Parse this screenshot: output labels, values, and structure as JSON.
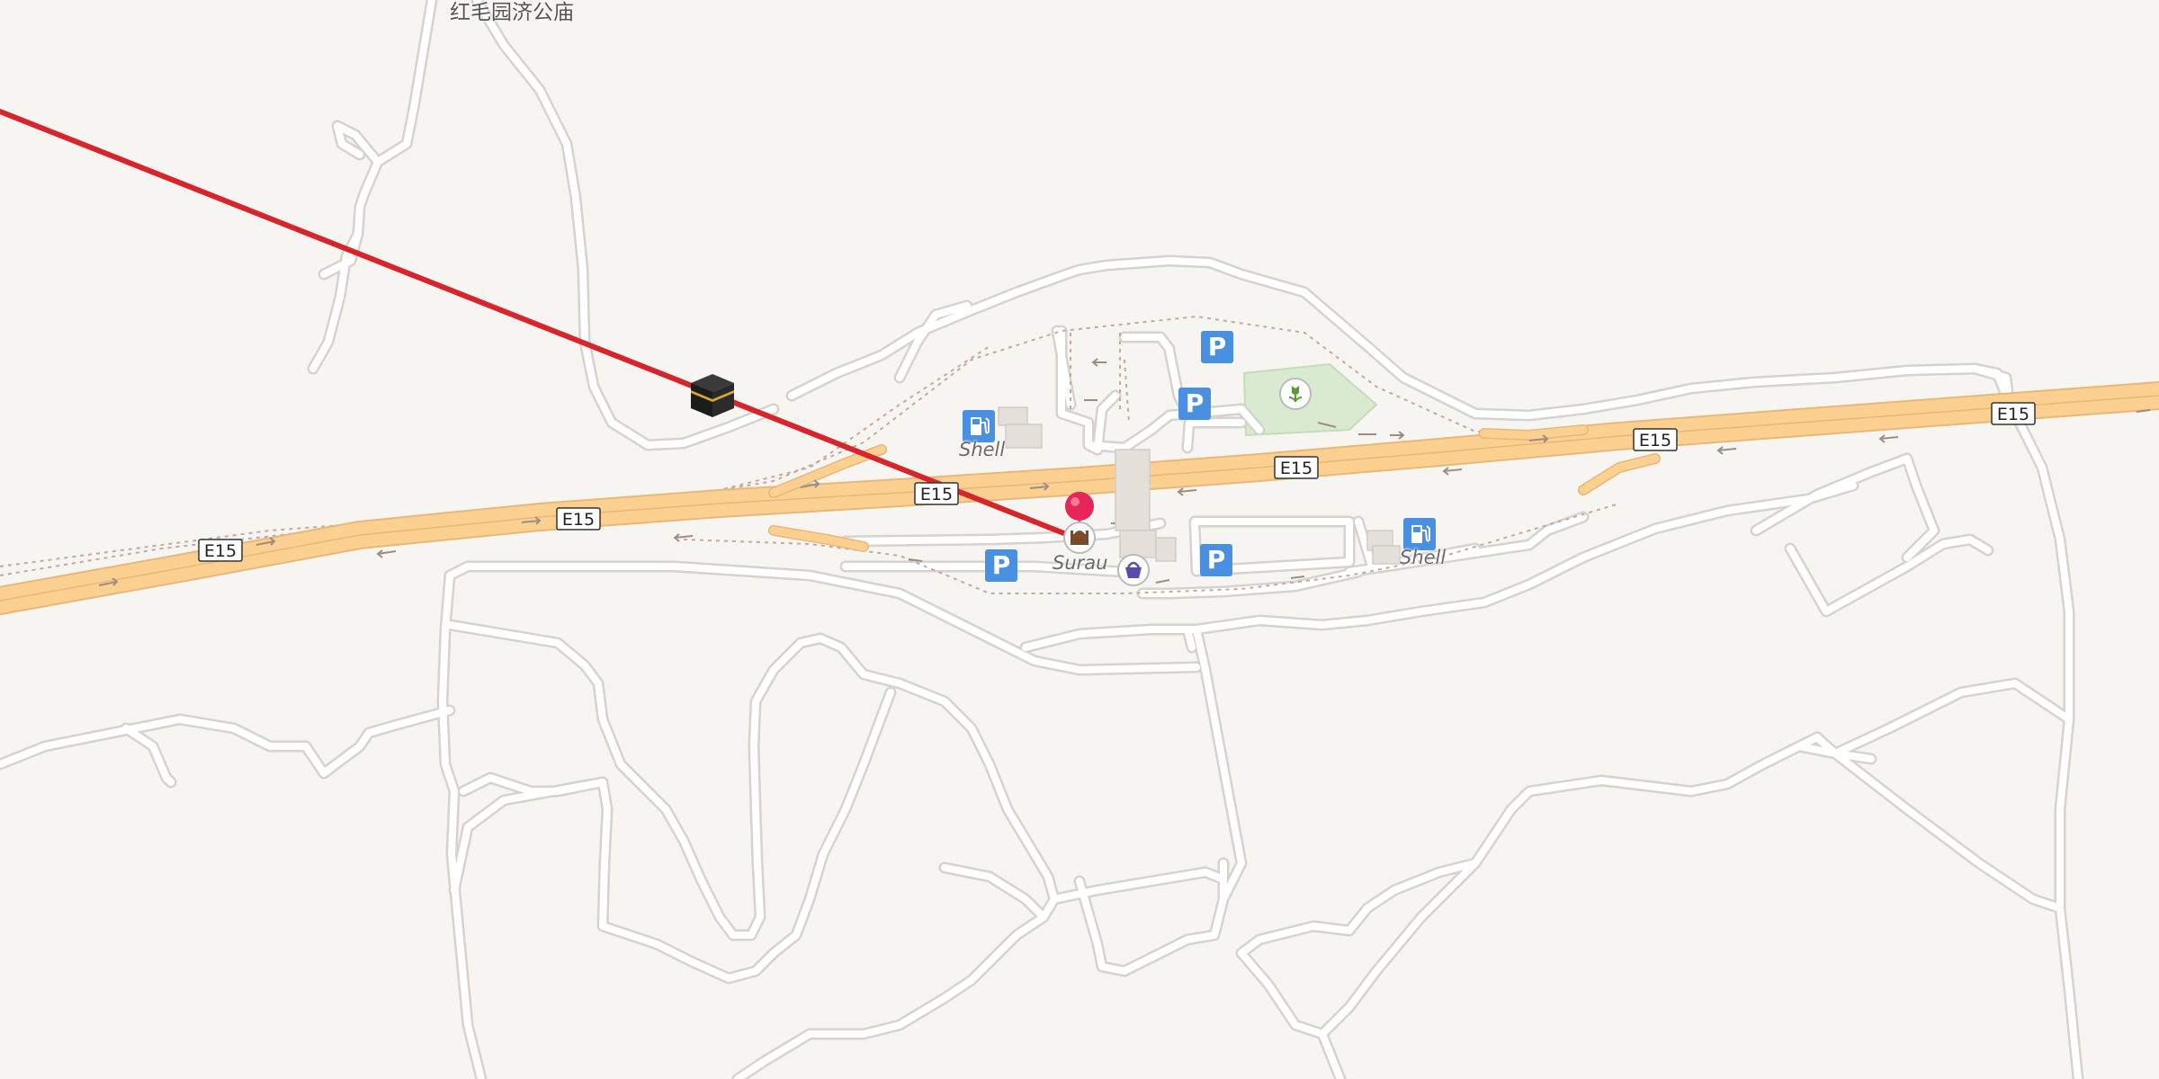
{
  "place_label": "红毛园济公庙",
  "highway_ref": "E15",
  "shields": [
    "E15",
    "E15",
    "E15",
    "E15",
    "E15",
    "E15"
  ],
  "poi_labels": {
    "shell_west": "Shell",
    "shell_east": "Shell",
    "surau": "Surau"
  },
  "parking_symbol": "P",
  "icons": {
    "fuel": "fuel-station-icon",
    "parking": "parking-icon",
    "mosque": "mosque-icon",
    "shop": "shopping-basket-icon",
    "park": "park-tulip-icon",
    "kaaba": "kaaba-icon",
    "pin": "location-pin-icon"
  },
  "colors": {
    "background": "#f7f5f2",
    "highway": "#fcd090",
    "qibla_line": "#d8252b",
    "pin": "#e8245a",
    "parking": "#4a90e2",
    "park": "#d9ead0"
  }
}
